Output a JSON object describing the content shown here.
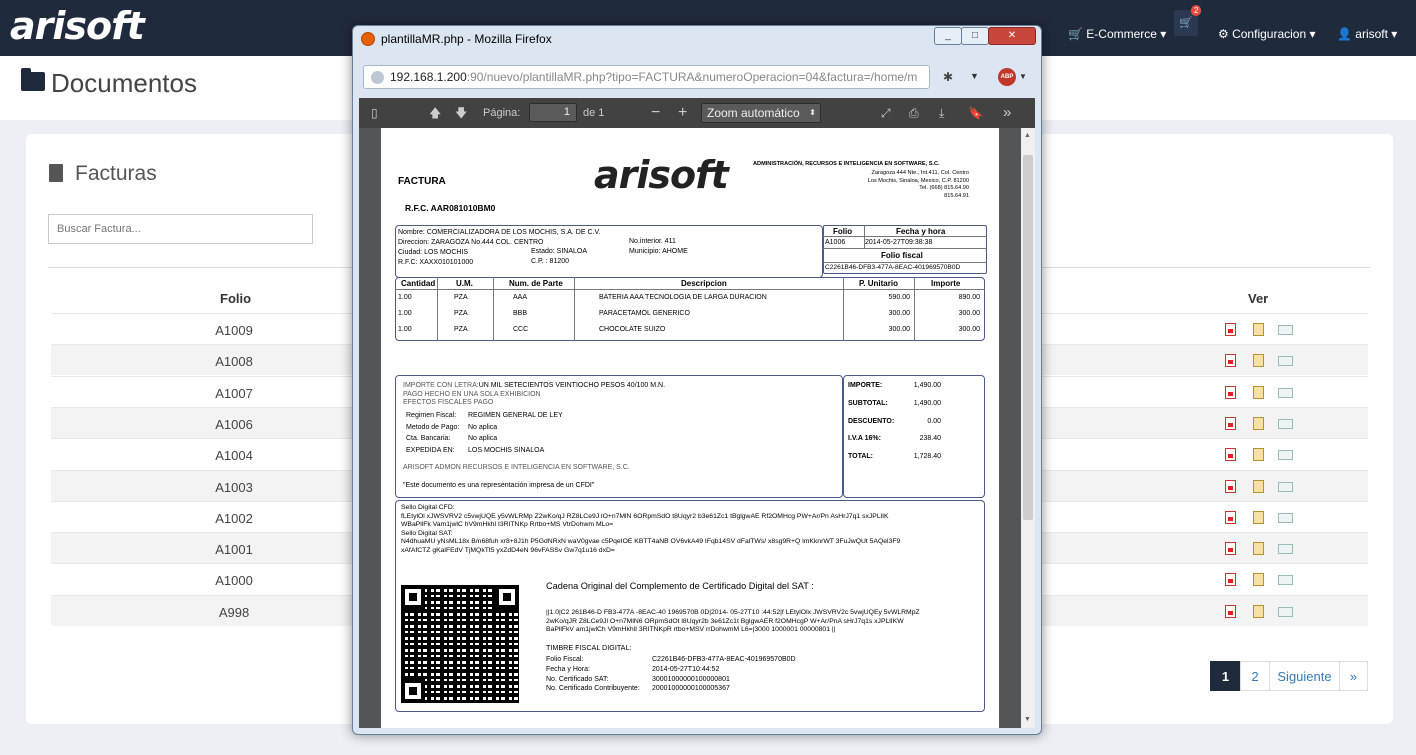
{
  "app": {
    "logo": "arisoft"
  },
  "nav": {
    "ecommerce": "E-Commerce",
    "cart_count": "2",
    "config": "Configuracion",
    "user": "arisoft"
  },
  "page": {
    "title": "Documentos"
  },
  "facturas": {
    "title": "Facturas",
    "search_placeholder": "Buscar Factura...",
    "col_folio": "Folio",
    "col_ver": "Ver",
    "rows": [
      "A1009",
      "A1008",
      "A1007",
      "A1006",
      "A1004",
      "A1003",
      "A1002",
      "A1001",
      "A1000",
      "A998"
    ]
  },
  "pagination": {
    "p1": "1",
    "p2": "2",
    "next": "Siguiente",
    "last": "»"
  },
  "popup": {
    "title": "plantillaMR.php - Mozilla Firefox",
    "url_host": "192.168.1.200",
    "url_rest": ":90/nuevo/plantillaMR.php?tipo=FACTURA&numeroOperacion=04&factura=/home/m",
    "page_label": "Página:",
    "page_num": "1",
    "page_of": "de 1",
    "zoom": "Zoom automático"
  },
  "invoice": {
    "factura": "FACTURA",
    "rfc_emisor": "R.F.C. AAR081010BM0",
    "logo": "arisoft",
    "company": "ADMINISTRACIÓN, RECURSOS E INTELIGENCIA EN SOFTWARE, S.C.",
    "addr": [
      "Zaragoza 444 Nte., Int.411, Col. Centro",
      "Los Mochis, Sinaloa, Mexico, C.P. 81200",
      "Tel. (668) 815.64.90",
      "815.64.91"
    ],
    "client": {
      "nombre_l": "Nombre:",
      "nombre": "COMERCIALIZADORA DE LOS MOCHIS, S.A. DE C.V.",
      "dir_l": "Direccion:",
      "dir": "ZARAGOZA No.444 COL. CENTRO",
      "noint": "No.interior. 411",
      "ciudad_l": "Ciudad:",
      "ciudad": "LOS MOCHIS",
      "estado": "Estado: SINALOA",
      "municipio": "Municipio: AHOME",
      "rfc_l": "R.F.C:",
      "rfc": "XAXX010101000",
      "cp": "C.P. : 81200"
    },
    "folio_h": "Folio",
    "fecha_h": "Fecha y hora",
    "folio": "A1006",
    "fecha": "2014-05-27T09:38:38",
    "folio_fiscal_h": "Folio fiscal",
    "folio_fiscal": "C2261B46-DFB3-477A-8EAC-401969570B0D",
    "cols": [
      "Cantidad",
      "U.M.",
      "Num. de Parte",
      "Descripcion",
      "P. Unitario",
      "Importe"
    ],
    "items": [
      [
        "1.00",
        "PZA",
        "AAA",
        "BATERIA AAA TECNOLOGIA DE LARGA DURACION",
        "590.00",
        "890.00"
      ],
      [
        "1.00",
        "PZA",
        "BBB",
        "PARACETAMOL GENERICO",
        "300.00",
        "300.00"
      ],
      [
        "1.00",
        "PZA",
        "CCC",
        "CHOCOLATE SUIZO",
        "300.00",
        "300.00"
      ]
    ],
    "letra_l": "IMPORTE CON LETRA:",
    "letra": "UN MIL SETECIENTOS VEINTIOCHO PESOS 40/100 M.N.",
    "pago": "PAGO HECHO EN UNA SOLA EXHIBICION",
    "efectos": "EFECTOS FISCALES PAGO",
    "regimen_l": "Regimen Fiscal:",
    "regimen": "REGIMEN GENERAL DE LEY",
    "metodo_l": "Metodo de Pago:",
    "metodo": "No aplica",
    "cta_l": "Cta. Bancaria:",
    "cta": "No aplica",
    "exp_l": "EXPEDIDA EN:",
    "exp": "LOS MOCHIS SINALOA",
    "admon": "ARISOFT ADMON RECURSOS E INTELIGENCIA EN SOFTWARE, S.C.",
    "leyenda": "\"Este documento es una representación impresa de un CFDI\"",
    "tot": [
      [
        "IMPORTE:",
        "1,490.00"
      ],
      [
        "SUBTOTAL:",
        "1,490.00"
      ],
      [
        "DESCUENTO:",
        "0.00"
      ],
      [
        "I.V.A 16%:",
        "238.40"
      ],
      [
        "TOTAL:",
        "1,728.40"
      ]
    ],
    "sello_cfd_l": "Sello Digital CFD:",
    "sello_cfd": [
      "fLEtylOl xJWSVRV2 c5vwjUQE y5vWLRMp Z2wKo/qJ RZ8LCe9J lO+n7MlN 6ORpmSdO t8Uqyr2 b3e61Zc1 tBglgwAE Rf2OMHcg PW+Ar/Pn AsHrJ7q1 sxJPLlIK",
      "WBaPllFk Vam1jwlC hV9mHkhl I3RITNKp Rrtbo+MS VtrDohwm MLo="
    ],
    "sello_sat_l": "Sello Digital SAT:",
    "sello_sat": [
      "N4dhuaMU yNsML18x B/n68fuh xr8+8J1h P5GdNRxN waV0gvae c5PqeIOE KBTT4aNB OV6vkA49 IFqb14SV dFalTWs/ x8sg9R+Q lmKknrWT 3FuJwQUt 5AQel3F9",
      "xAfAfCTZ gKalFEdV TjMQkTt5 yxZdD4eN 96vFASSv Gw7q1u16 dxD="
    ],
    "cadena_t": "Cadena Original del Complemento de Certificado Digital del SAT :",
    "cadena": [
      "||1.0|C2 261B46-D FB3-477A -8EAC-40 1969570B 0D|2014- 05-27T10 :44:52|f LEtylOlx JWSVRV2c 5vwjUQEy 5vWLRMpZ",
      "2wKo/qJR Z8LCe9Jl O+n7MlN6 ORpmSdOt l8Uqyr2b 3e61Zc1t BglgwAER f2OMHcgP W+Ar/PnA sHrJ7q1s xJPLlIKW",
      "BaPllFkV am1jwlCh V9mHkhlI 3RITNKpR rtbo+MSV rrDohwmM L6=|3000 1000001 00000801 ||"
    ],
    "timbre_t": "TIMBRE FISCAL DIGITAL:",
    "timbre": [
      [
        "Folio Fiscal:",
        "C2261B46-DFB3-477A-8EAC-401969570B0D"
      ],
      [
        "Fecha y Hora:",
        "2014-05-27T10:44:52"
      ],
      [
        "No. Certificado SAT:",
        "30001000000100000801"
      ],
      [
        "No. Certificado Contribuyente:",
        "20001000000100005367"
      ]
    ]
  }
}
